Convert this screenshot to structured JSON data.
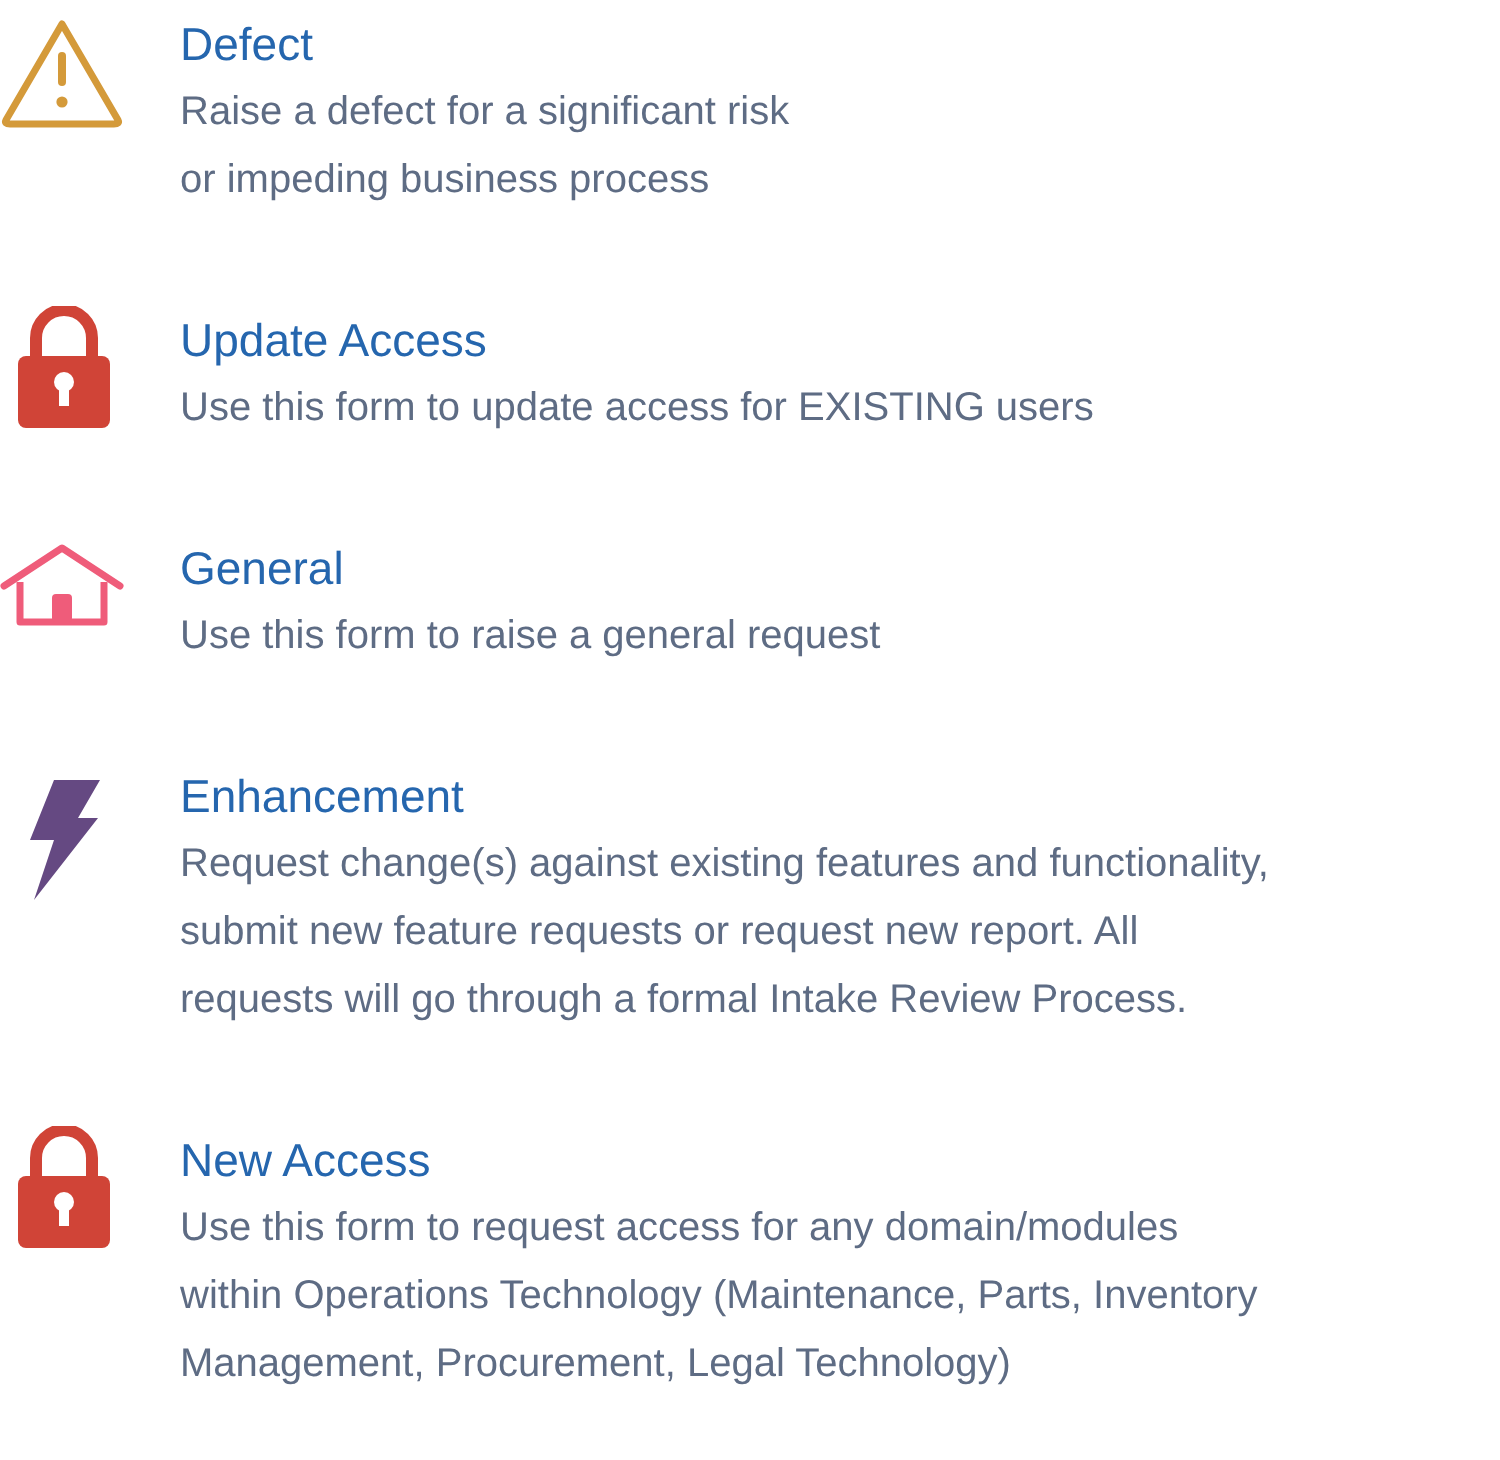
{
  "request_types": [
    {
      "kind": "warning",
      "title": "Defect",
      "description": [
        "Raise a defect for a significant risk",
        "or impeding business process"
      ]
    },
    {
      "kind": "lock",
      "title": "Update Access",
      "description": [
        "Use this form to update access for EXISTING users"
      ]
    },
    {
      "kind": "house",
      "title": "General",
      "description": [
        "Use this form to raise a general request"
      ]
    },
    {
      "kind": "bolt",
      "title": "Enhancement",
      "description": [
        "Request change(s) against existing features and functionality,",
        "submit new feature requests or request new report. All",
        "requests will go through a formal Intake Review Process."
      ]
    },
    {
      "kind": "lock",
      "title": "New Access",
      "description": [
        "Use this form to request access for any domain/modules",
        "within Operations Technology (Maintenance, Parts, Inventory",
        "Management, Procurement, Legal Technology)"
      ]
    }
  ]
}
